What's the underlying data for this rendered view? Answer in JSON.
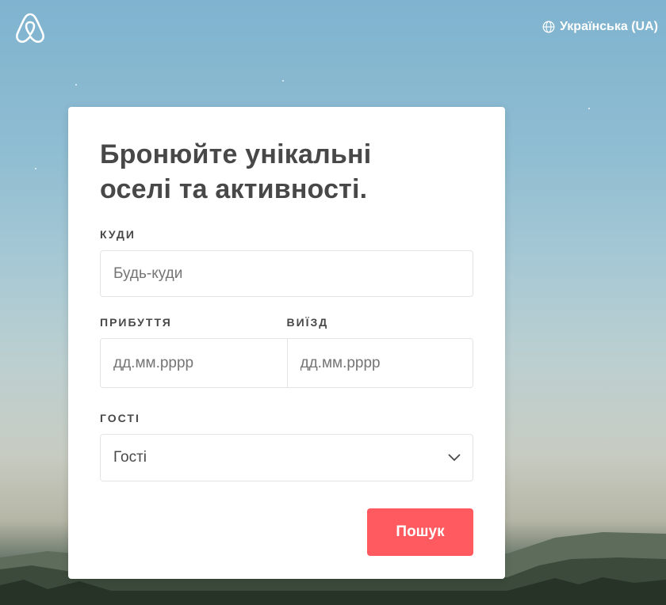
{
  "header": {
    "logo_icon": "airbnb-belo-icon",
    "language_icon": "globe-icon",
    "language_label": "Українська (UA)"
  },
  "search_card": {
    "headline_line1": "Бронюйте унікальні",
    "headline_line2": "оселі та активності.",
    "where": {
      "label": "КУДИ",
      "placeholder": "Будь-куди"
    },
    "check_in": {
      "label": "ПРИБУТТЯ",
      "placeholder": "дд.мм.рррр"
    },
    "check_out": {
      "label": "ВИЇЗД",
      "placeholder": "дд.мм.рррр"
    },
    "guests": {
      "label": "ГОСТІ",
      "value": "Гості",
      "icon": "chevron-down-icon"
    },
    "search_button": "Пошук"
  },
  "colors": {
    "brand": "#ff5a5f",
    "text": "#484848",
    "border": "#e4e4e4"
  }
}
